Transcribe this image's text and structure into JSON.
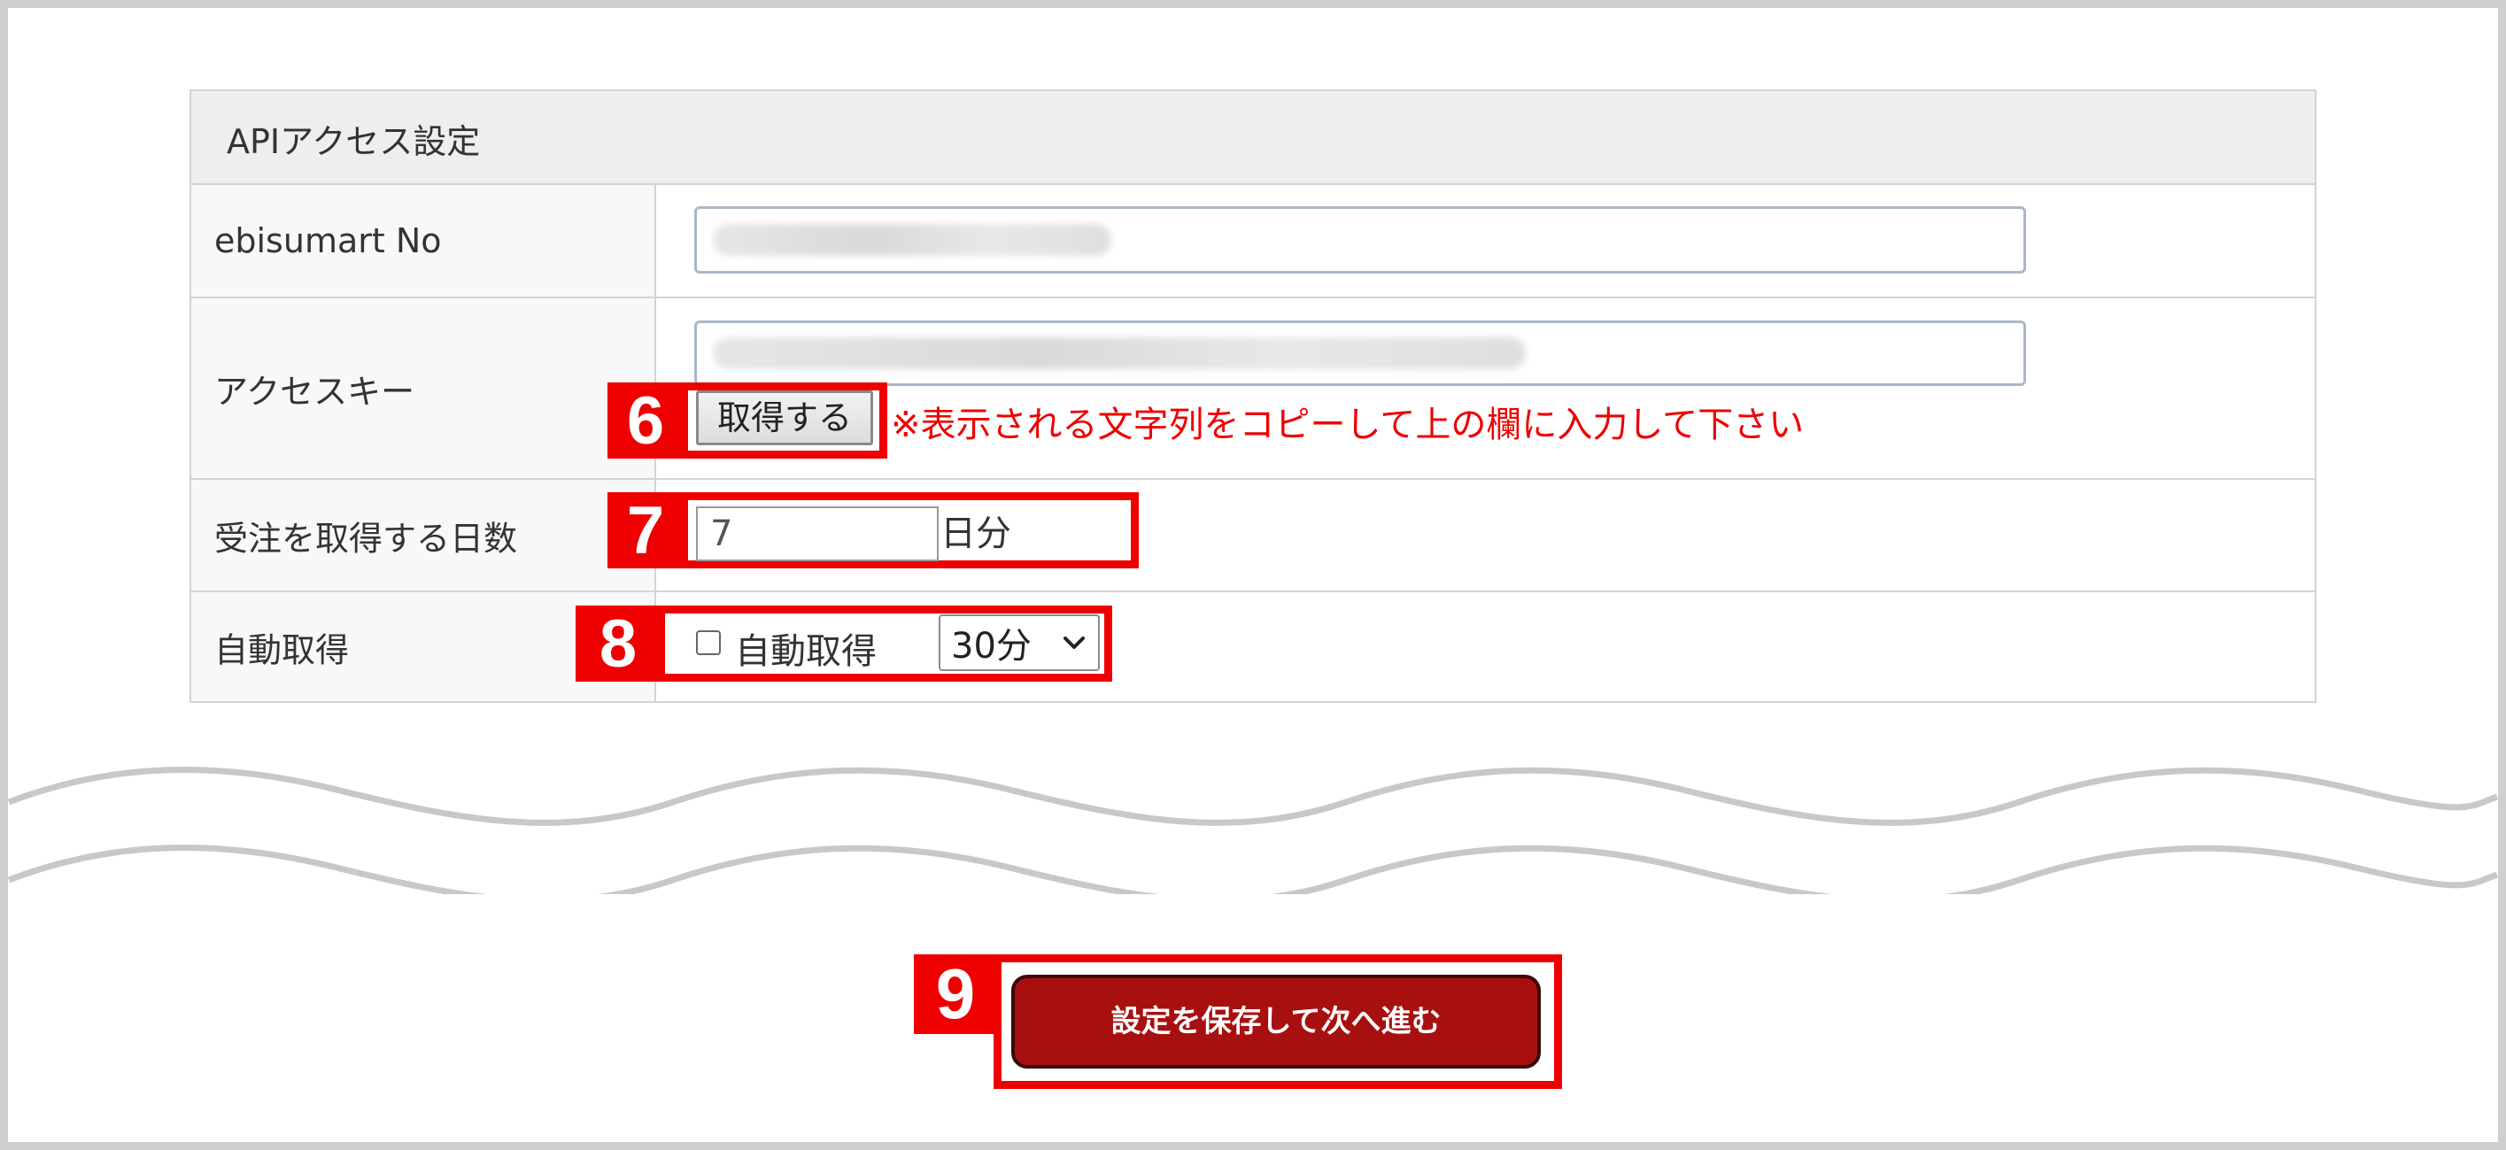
{
  "panel": {
    "title": "APIアクセス設定"
  },
  "fields": {
    "ebisumart_no": {
      "label": "ebisumart No",
      "value": "",
      "blurred": true
    },
    "access_key": {
      "label": "アクセスキー",
      "value": "",
      "blurred": true,
      "fetch_button": "取得する",
      "note": "※表示される文字列をコピーして上の欄に入力して下さい"
    },
    "order_days": {
      "label": "受注を取得する日数",
      "value": "7",
      "unit": "日分"
    },
    "auto_fetch": {
      "label": "自動取得",
      "checkbox_label": "自動取得",
      "checked": false,
      "interval": "30分"
    }
  },
  "callouts": {
    "six": "6",
    "seven": "7",
    "eight": "8",
    "nine": "9"
  },
  "footer": {
    "save_button": "設定を保存して次へ進む"
  },
  "colors": {
    "callout_red": "#ee0000",
    "save_button_bg": "#a81010",
    "note_text": "#ee0000",
    "header_bg": "#eeeeee",
    "border": "#d4d4d4"
  },
  "icons": {
    "select_chevron": "chevron-down-icon"
  }
}
